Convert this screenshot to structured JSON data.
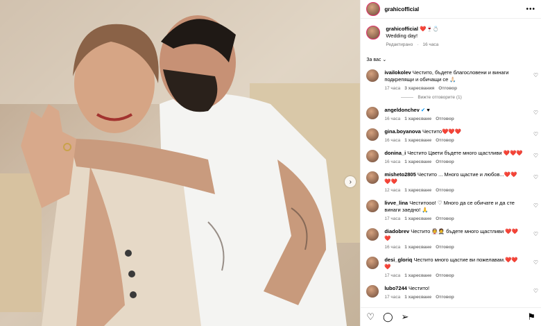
{
  "header": {
    "username": "grahicofficial",
    "more": "•••"
  },
  "caption": {
    "username": "grahicofficial",
    "emojis": "❤️🍷💍",
    "text": "Wedding day!",
    "edited": "Редактирано",
    "time": "16 часа"
  },
  "for_you": "За вас",
  "comments": [
    {
      "user": "ivailokolev",
      "text": "Честито, бъдете благословени и винаги подкрепящи и обичащи се 🙏🏻",
      "time": "17 часа",
      "likes": "3 харесвания",
      "reply": "Отговор",
      "replies": "Вижте отговорите (1)"
    },
    {
      "user": "angeldonchev",
      "text": "♥",
      "verified": true,
      "time": "16 часа",
      "likes": "1 харесване",
      "reply": "Отговор"
    },
    {
      "user": "gina.boyanova",
      "text": "Честито❤️❤️❤️",
      "time": "16 часа",
      "likes": "1 харесване",
      "reply": "Отговор"
    },
    {
      "user": "donina_i",
      "text": "Честито Цвети бъдете много щастливи ❤️❤️❤️",
      "time": "16 часа",
      "likes": "1 харесване",
      "reply": "Отговор"
    },
    {
      "user": "misheto2805",
      "text": "Честито ... Много щастие и любов...❤️❤️❤️❤️",
      "time": "12 часа",
      "likes": "1 харесване",
      "reply": "Отговор"
    },
    {
      "user": "livve_lina",
      "text": "Честитооо! ♡ Много да се обичате и да сте винаги заедно! 🙏",
      "time": "17 часа",
      "likes": "1 харесване",
      "reply": "Отговор"
    },
    {
      "user": "diadobrev",
      "text": "Честито 👰🤵 бъдете много щастливи ❤️❤️❤️",
      "time": "16 часа",
      "likes": "1 харесване",
      "reply": "Отговор"
    },
    {
      "user": "desi_gloriq",
      "text": "Честито много щастие ви пожелавам.❤️❤️❤️",
      "time": "17 часа",
      "likes": "1 харесване",
      "reply": "Отговор"
    },
    {
      "user": "lubo7244",
      "text": "Честито!",
      "time": "17 часа",
      "likes": "1 харесване",
      "reply": "Отговор"
    }
  ],
  "footer": {
    "like_icon": "heart-icon",
    "comment_icon": "comment-icon",
    "share_icon": "share-icon",
    "save_icon": "bookmark-icon"
  },
  "colors": {
    "accent": "#0095f6",
    "heart": "#e0262c",
    "muted": "#737373"
  }
}
